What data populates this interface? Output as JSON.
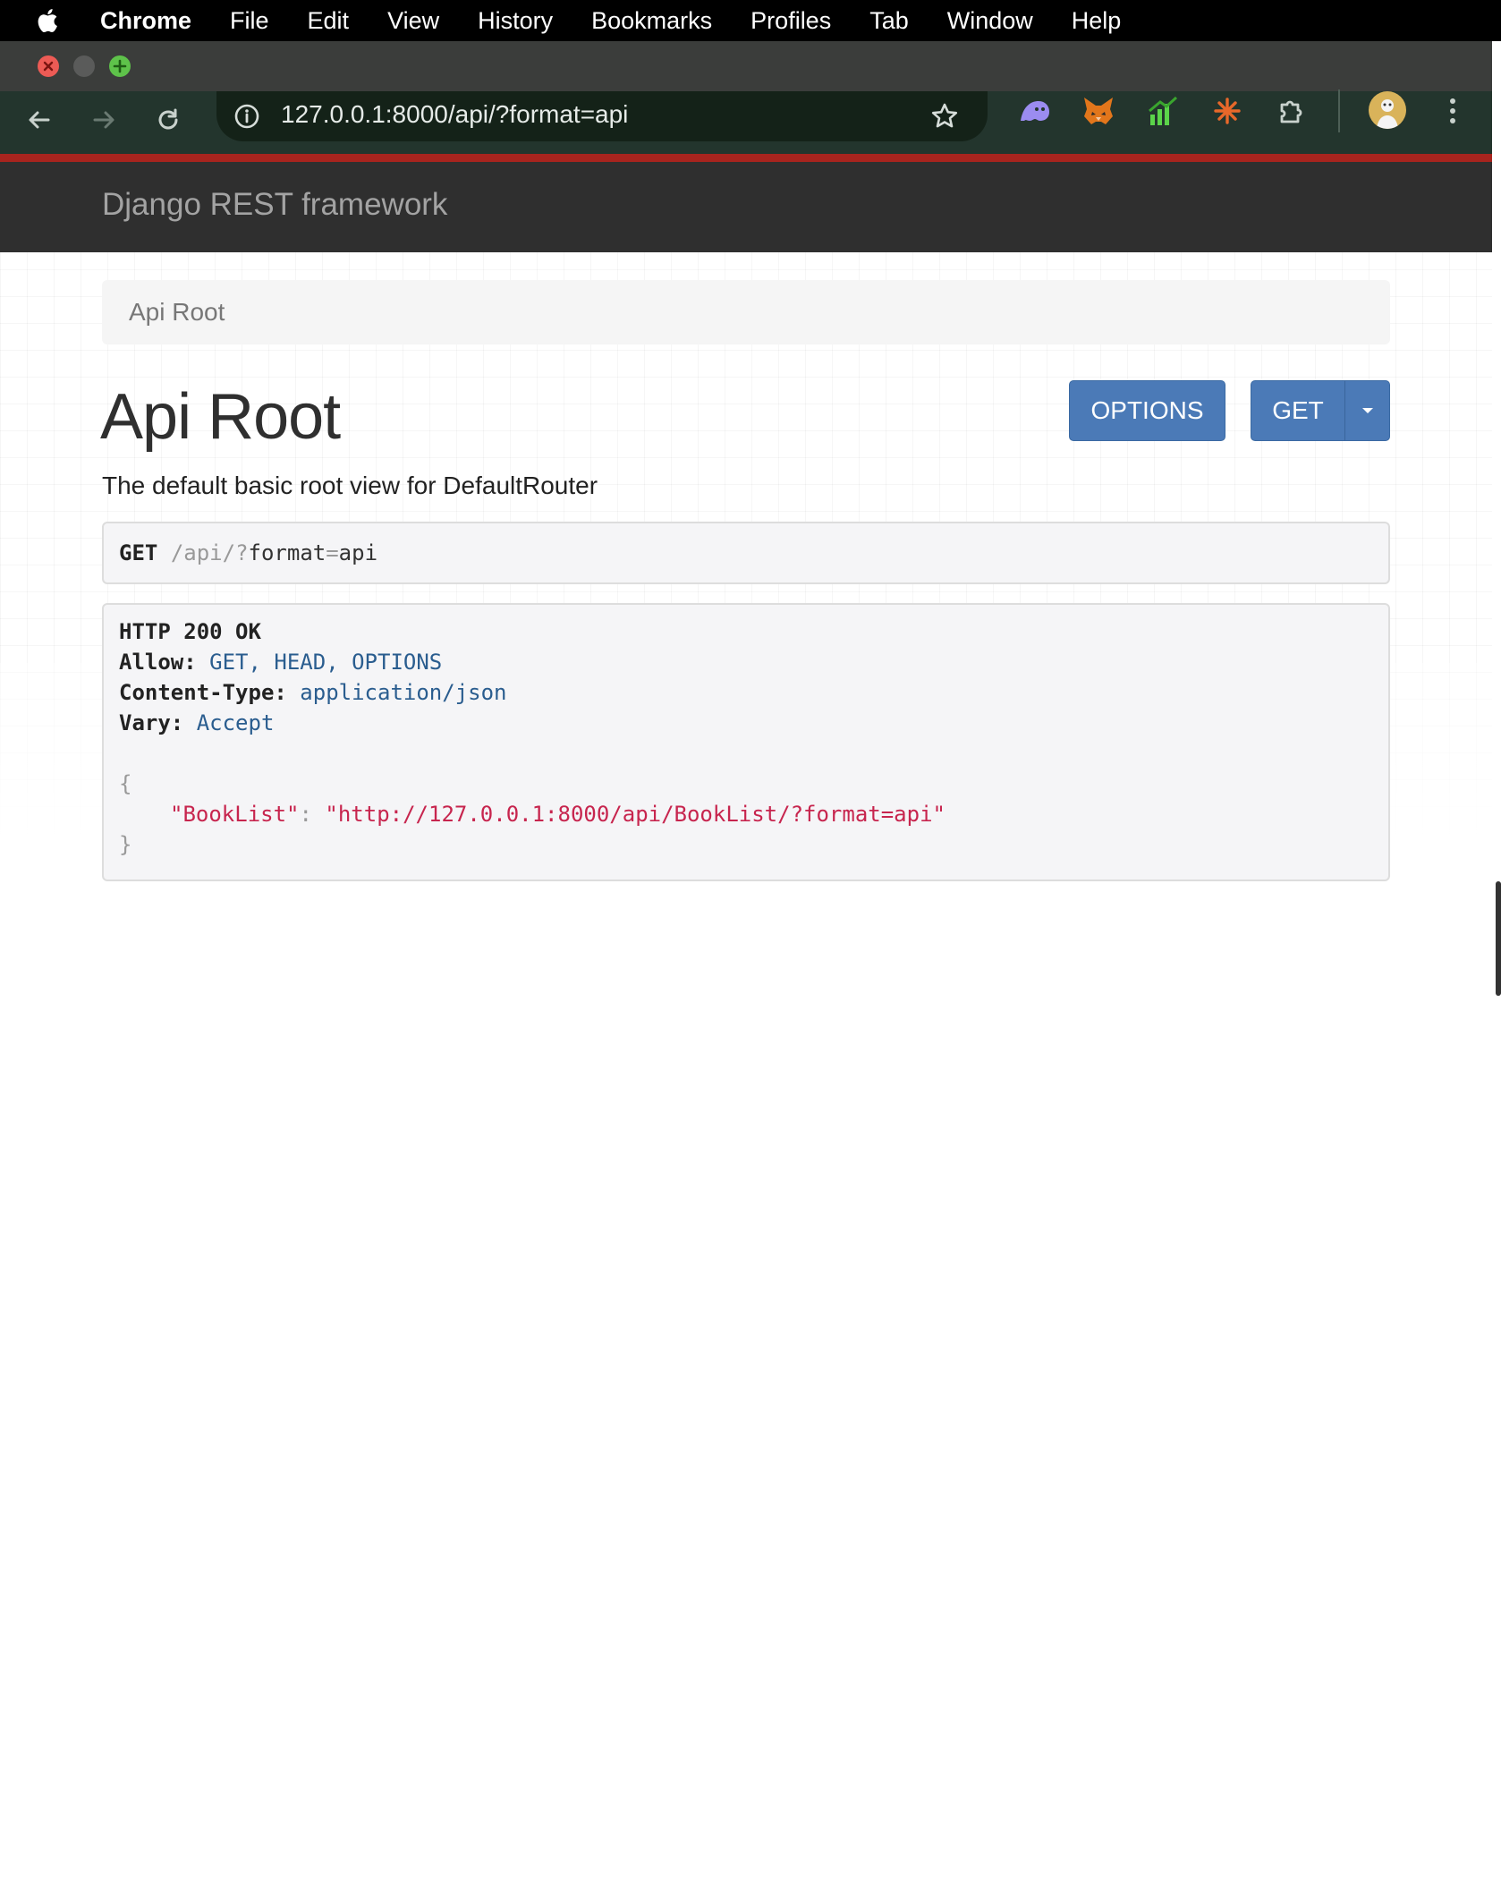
{
  "menubar": {
    "apple_icon": "apple-icon",
    "items": [
      "Chrome",
      "File",
      "Edit",
      "View",
      "History",
      "Bookmarks",
      "Profiles",
      "Tab",
      "Window",
      "Help"
    ]
  },
  "browser": {
    "url": "127.0.0.1:8000/api/?format=api",
    "icons": [
      "back-arrow-icon",
      "forward-arrow-icon",
      "reload-icon",
      "site-info-icon",
      "bookmark-star-icon",
      "ghost-extension-icon",
      "fox-extension-icon",
      "chart-extension-icon",
      "sparkle-extension-icon",
      "extensions-puzzle-icon",
      "profile-avatar",
      "menu-dots-icon"
    ],
    "accent_color": "#a8241e"
  },
  "navbar": {
    "brand": "Django REST framework"
  },
  "breadcrumb": {
    "current": "Api Root"
  },
  "content": {
    "title": "Api Root",
    "options_label": "OPTIONS",
    "get_label": "GET",
    "description": "The default basic root view for DefaultRouter"
  },
  "request": {
    "method": "GET",
    "path_a": "/api/",
    "q": "?",
    "param": "format",
    "eq": "=",
    "value": "api"
  },
  "response": {
    "status": "HTTP 200 OK",
    "headers": [
      {
        "key": "Allow:",
        "value": "GET, HEAD, OPTIONS"
      },
      {
        "key": "Content-Type:",
        "value": "application/json"
      },
      {
        "key": "Vary:",
        "value": "Accept"
      }
    ],
    "body_open": "{",
    "body_key": "\"BookList\"",
    "body_sep": ": ",
    "body_value": "\"http://127.0.0.1:8000/api/BookList/?format=api\"",
    "body_close": "}"
  }
}
